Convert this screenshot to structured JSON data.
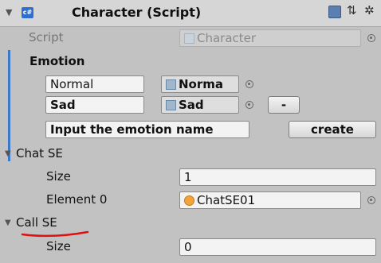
{
  "component": {
    "title": "Character (Script)",
    "icon": "csharp-script-icon",
    "script_label": "Script",
    "script_value": "Character"
  },
  "emotion": {
    "header": "Emotion",
    "rows": [
      {
        "name": "Normal",
        "sprite": "Norma"
      },
      {
        "name": "Sad",
        "sprite": "Sad",
        "remove_label": "-"
      }
    ],
    "input_value": "Input the emotion name",
    "create_label": "create"
  },
  "chat_se": {
    "label": "Chat SE",
    "size_label": "Size",
    "size_value": "1",
    "element_label": "Element 0",
    "element_value": "ChatSE01"
  },
  "call_se": {
    "label": "Call SE",
    "size_label": "Size",
    "size_value": "0"
  },
  "colors": {
    "panel": "#c2c2c2",
    "header": "#d6d6d6",
    "accent": "#3a78c9",
    "annotation": "#e01010"
  }
}
